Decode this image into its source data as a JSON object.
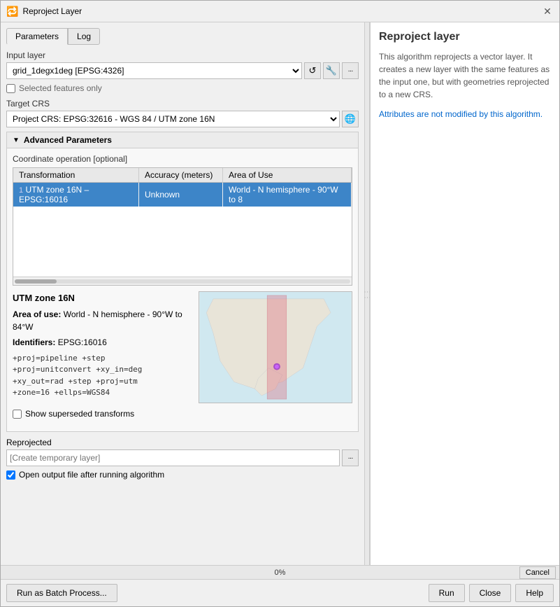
{
  "window": {
    "title": "Reproject Layer",
    "icon": "🔁"
  },
  "tabs": [
    {
      "id": "parameters",
      "label": "Parameters",
      "active": true
    },
    {
      "id": "log",
      "label": "Log",
      "active": false
    }
  ],
  "input_layer": {
    "label": "Input layer",
    "value": "grid_1degx1deg [EPSG:4326]",
    "selected_features_only": "Selected features only",
    "selected_features_checked": false
  },
  "target_crs": {
    "label": "Target CRS",
    "value": "Project CRS: EPSG:32616 - WGS 84 / UTM zone 16N"
  },
  "advanced_params": {
    "header": "Advanced Parameters",
    "coord_operation_label": "Coordinate operation [optional]",
    "table": {
      "columns": [
        "Transformation",
        "Accuracy (meters)",
        "Area of Use"
      ],
      "rows": [
        {
          "num": "1",
          "transformation": "UTM zone 16N – EPSG:16016",
          "accuracy": "Unknown",
          "area": "World - N hemisphere - 90°W to 8",
          "selected": true
        }
      ]
    }
  },
  "info": {
    "name": "UTM zone 16N",
    "area_of_use_label": "Area of use:",
    "area_of_use_value": "World - N hemisphere - 90°W to 84°W",
    "identifiers_label": "Identifiers:",
    "identifiers_value": "EPSG:16016",
    "proj_string": "+proj=pipeline +step\n+proj=unitconvert +xy_in=deg\n+xy_out=rad +step +proj=utm\n+zone=16 +ellps=WGS84"
  },
  "show_superseded": {
    "label": "Show superseded transforms",
    "checked": false
  },
  "output": {
    "label": "Reprojected",
    "placeholder": "[Create temporary layer]",
    "open_output_label": "Open output file after running algorithm",
    "open_output_checked": true
  },
  "progress": {
    "percent": "0%",
    "value": 0
  },
  "buttons": {
    "batch_process": "Run as Batch Process...",
    "run": "Run",
    "close": "Close",
    "help": "Help",
    "cancel": "Cancel"
  },
  "right_panel": {
    "title": "Reproject layer",
    "description": "This algorithm reprojects a vector layer. It creates a new layer with the same features as the input one, but with geometries reprojected to a new CRS.",
    "note": "Attributes are not modified by this algorithm."
  },
  "icons": {
    "refresh": "↺",
    "wrench": "🔧",
    "dots": "...",
    "globe": "🌐",
    "triangle_down": "▼",
    "chevron_right": "▶",
    "arrow_right": "→"
  }
}
